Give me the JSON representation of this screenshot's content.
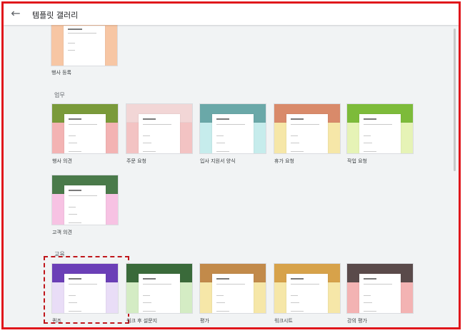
{
  "header": {
    "back_icon": "arrow-left-icon",
    "title": "템플릿 갤러리"
  },
  "sections": {
    "work": "업무",
    "education": "교육"
  },
  "templates": {
    "top": {
      "label": "행사 등록",
      "colors": {
        "header": "#8b6a57",
        "side": "#f7c6a4"
      }
    },
    "work": [
      {
        "label": "행사 의견",
        "colors": {
          "header": "#7a9a3a",
          "side": "#f3b3b3"
        }
      },
      {
        "label": "주문 요청",
        "colors": {
          "header": "#f2d6d6",
          "side": "#f3c3c3"
        }
      },
      {
        "label": "입사 지원서 양식",
        "colors": {
          "header": "#6aa8a8",
          "side": "#c6ecec"
        }
      },
      {
        "label": "휴가 요청",
        "colors": {
          "header": "#d98a6a",
          "side": "#f6e7a8"
        }
      },
      {
        "label": "작업 요청",
        "colors": {
          "header": "#7dbb3a",
          "side": "#e6f3b6"
        }
      }
    ],
    "work_row2": [
      {
        "label": "고객 의견",
        "colors": {
          "header": "#4a7a4a",
          "side": "#f7c2e3"
        }
      }
    ],
    "education": [
      {
        "label": "퀴즈",
        "colors": {
          "header": "#6b3fb7",
          "side": "#e9ddf7"
        }
      },
      {
        "label": "워크 후 설문지",
        "colors": {
          "header": "#3a6a3a",
          "side": "#d4ecc4"
        }
      },
      {
        "label": "평가",
        "colors": {
          "header": "#c28a4a",
          "side": "#f6e7a8"
        }
      },
      {
        "label": "워크시트",
        "colors": {
          "header": "#d7a24a",
          "side": "#f6e7a8"
        }
      },
      {
        "label": "강의 평가",
        "colors": {
          "header": "#5a4a4a",
          "side": "#f3b3b3"
        }
      }
    ]
  }
}
